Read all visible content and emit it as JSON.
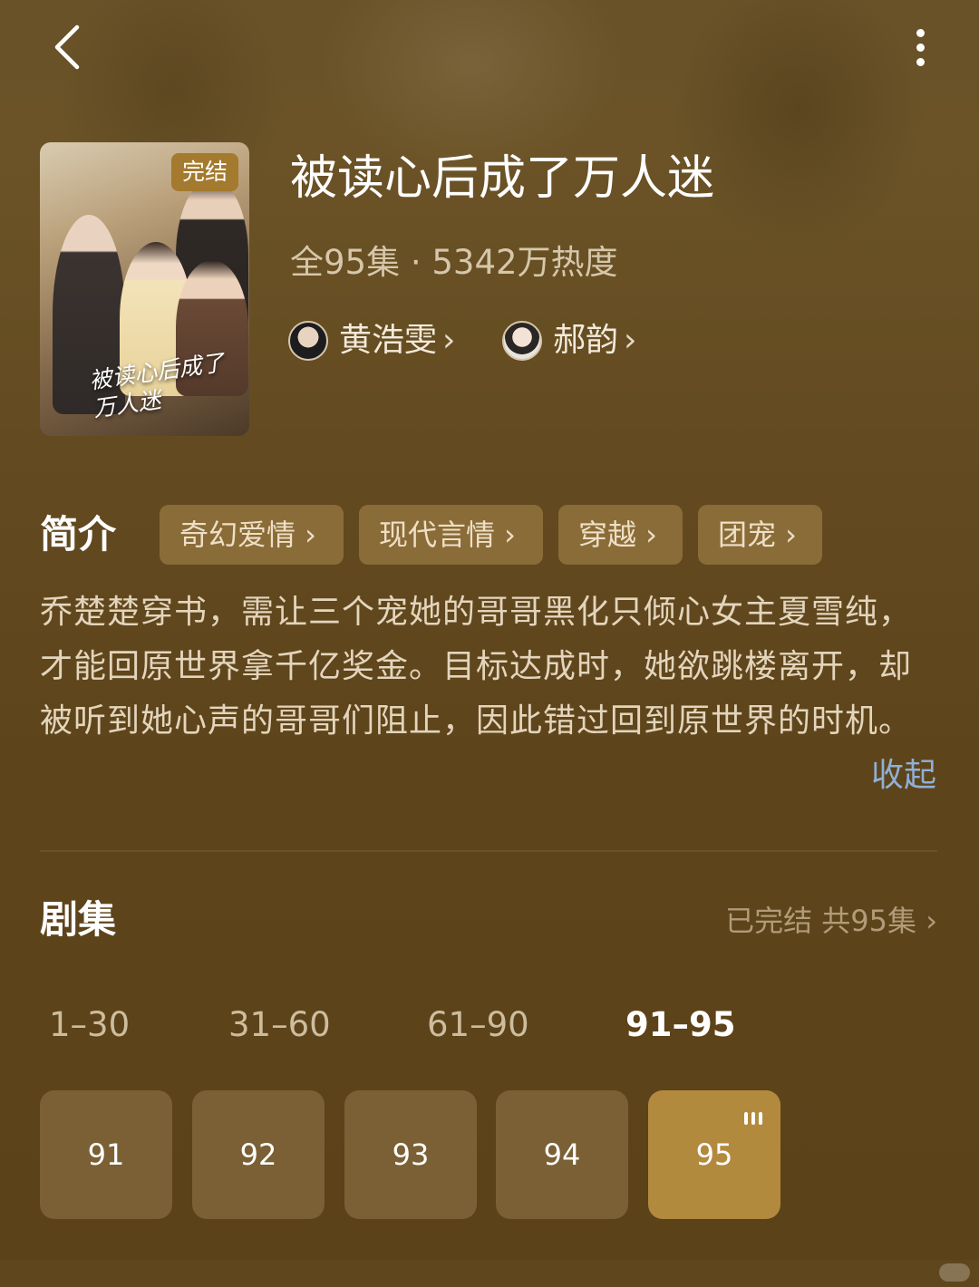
{
  "topbar": {
    "back_icon": "chevron-left-icon",
    "more_icon": "more-vertical-icon"
  },
  "cover": {
    "badge": "完结",
    "title_art": "被读心后成了万人迷"
  },
  "show": {
    "title": "被读心后成了万人迷",
    "meta": "全95集 · 5342万热度"
  },
  "actors": [
    {
      "name": "黄浩雯",
      "chevron": "›"
    },
    {
      "name": "郝韵",
      "chevron": "›"
    }
  ],
  "intro": {
    "label": "简介",
    "tags": [
      "奇幻爱情 ›",
      "现代言情 ›",
      "穿越 ›",
      "团宠 ›"
    ],
    "description": "乔楚楚穿书，需让三个宠她的哥哥黑化只倾心女主夏雪纯，才能回原世界拿千亿奖金。目标达成时，她欲跳楼离开，却被听到她心声的哥哥们阻止，因此错过回到原世界的时机。",
    "collapse_label": "收起"
  },
  "episodes": {
    "label": "剧集",
    "status": "已完结 共95集 ›",
    "ranges": [
      "1–30",
      "31–60",
      "61–90",
      "91–95"
    ],
    "active_range": "91–95",
    "items": [
      "91",
      "92",
      "93",
      "94",
      "95"
    ],
    "current": "95",
    "playing_icon": "playing-bars-icon"
  },
  "colors": {
    "background": "#5e441a",
    "tag_bg": "#8a6c38",
    "episode_bg": "#7a6034",
    "episode_current_bg": "#b28a3e",
    "link": "#8fb0d6"
  }
}
